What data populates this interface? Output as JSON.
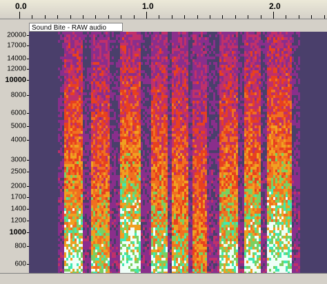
{
  "ruler": {
    "labels": [
      {
        "text": "0.0",
        "value": 0.0
      },
      {
        "text": "1.0",
        "value": 1.0
      },
      {
        "text": "2.0",
        "value": 2.0
      }
    ]
  },
  "track": {
    "title": "Sound Bite - RAW audio"
  },
  "freq_axis": {
    "labels": [
      {
        "text": "20000",
        "hz": 20000,
        "bold": false
      },
      {
        "text": "17000",
        "hz": 17000,
        "bold": false
      },
      {
        "text": "14000",
        "hz": 14000,
        "bold": false
      },
      {
        "text": "12000",
        "hz": 12000,
        "bold": false
      },
      {
        "text": "10000",
        "hz": 10000,
        "bold": true
      },
      {
        "text": "8000",
        "hz": 8000,
        "bold": false
      },
      {
        "text": "6000",
        "hz": 6000,
        "bold": false
      },
      {
        "text": "5000",
        "hz": 5000,
        "bold": false
      },
      {
        "text": "4000",
        "hz": 4000,
        "bold": false
      },
      {
        "text": "3000",
        "hz": 3000,
        "bold": false
      },
      {
        "text": "2500",
        "hz": 2500,
        "bold": false
      },
      {
        "text": "2000",
        "hz": 2000,
        "bold": false
      },
      {
        "text": "1700",
        "hz": 1700,
        "bold": false
      },
      {
        "text": "1400",
        "hz": 1400,
        "bold": false
      },
      {
        "text": "1200",
        "hz": 1200,
        "bold": false
      },
      {
        "text": "1000",
        "hz": 1000,
        "bold": true
      },
      {
        "text": "800",
        "hz": 800,
        "bold": false
      },
      {
        "text": "600",
        "hz": 600,
        "bold": false
      }
    ]
  },
  "colors": {
    "background": "#4a3f6b",
    "low": "#7a2a8a",
    "mid": "#e8401f",
    "high": "#f0a020",
    "peak": "#40e8b0",
    "max": "#f0fff8"
  }
}
